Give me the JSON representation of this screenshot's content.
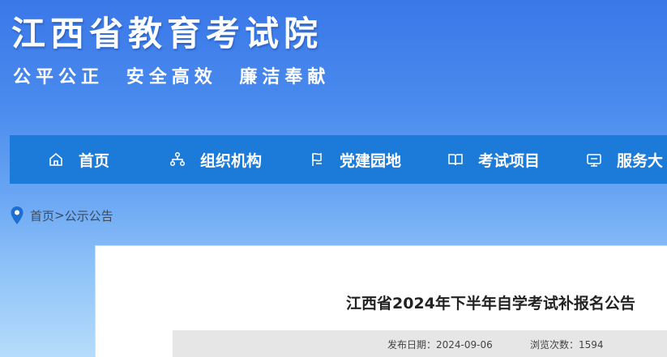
{
  "header": {
    "site_title": "江西省教育考试院",
    "slogan": [
      "公平公正",
      "安全高效",
      "廉洁奉献"
    ]
  },
  "nav": {
    "items": [
      {
        "label": "首页",
        "icon": "home-icon"
      },
      {
        "label": "组织机构",
        "icon": "org-chart-icon"
      },
      {
        "label": "党建园地",
        "icon": "party-building-icon"
      },
      {
        "label": "考试项目",
        "icon": "book-icon"
      },
      {
        "label": "服务大",
        "icon": "service-icon"
      }
    ]
  },
  "breadcrumb": {
    "icon": "location-pin-icon",
    "items": [
      "首页",
      ">",
      "公示公告"
    ]
  },
  "article": {
    "title": "江西省2024年下半年自学考试补报名公告",
    "publish_label": "发布日期：",
    "publish_date": "2024-09-06",
    "views_label": "浏览次数：",
    "views": "1594"
  },
  "colors": {
    "nav_bg": "#1c7ad9",
    "header_gradient_top": "#3a78e8",
    "header_gradient_bottom": "#b6dcfb",
    "pin": "#1c6fd0"
  }
}
